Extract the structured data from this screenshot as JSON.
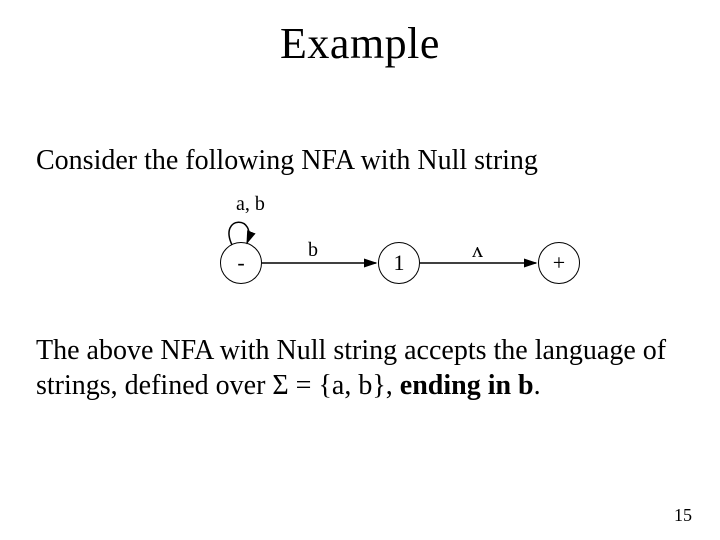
{
  "title": "Example",
  "intro": "Consider the following NFA with Null string",
  "diagram": {
    "self_loop_label": "a, b",
    "trans1_label": "b",
    "trans2_label": "ʌ",
    "state_minus": "-",
    "state_one": "1",
    "state_plus": "+"
  },
  "conclusion": {
    "part1": "The above NFA with Null string accepts the language of strings, defined over Σ = {a, b}, ",
    "bold": "ending in b",
    "part2": "."
  },
  "page_number": "15"
}
